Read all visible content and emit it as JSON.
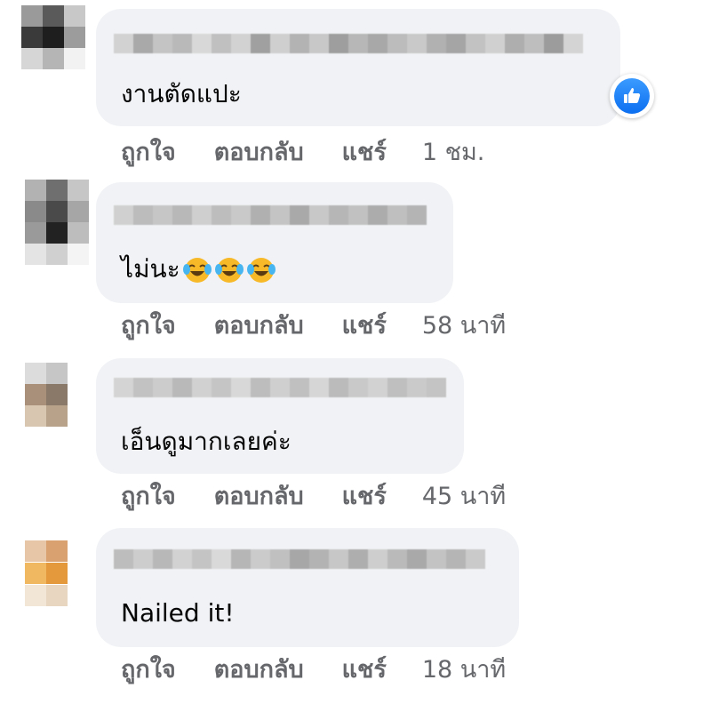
{
  "colors": {
    "bubble": "#f0f2f5",
    "action_text": "#65676b",
    "like_blue": "#1877f2"
  },
  "comments": [
    {
      "author": "",
      "text": "งานตัดแปะ",
      "actions": {
        "like": "ถูกใจ",
        "reply": "ตอบกลับ",
        "share": "แชร์"
      },
      "time": "1 ชม.",
      "reaction_icon": "like-icon"
    },
    {
      "author": "",
      "text": "ไม่นะ",
      "emoji_icon": "laughing-tears-emoji-icon",
      "emoji_count": 3,
      "actions": {
        "like": "ถูกใจ",
        "reply": "ตอบกลับ",
        "share": "แชร์"
      },
      "time": "58 นาที"
    },
    {
      "author": "",
      "text": "เอ็นดูมากเลยค่ะ",
      "actions": {
        "like": "ถูกใจ",
        "reply": "ตอบกลับ",
        "share": "แชร์"
      },
      "time": "45 นาที"
    },
    {
      "author": "",
      "text": "Nailed it!",
      "actions": {
        "like": "ถูกใจ",
        "reply": "ตอบกลับ",
        "share": "แชร์"
      },
      "time": "18 นาที"
    }
  ]
}
